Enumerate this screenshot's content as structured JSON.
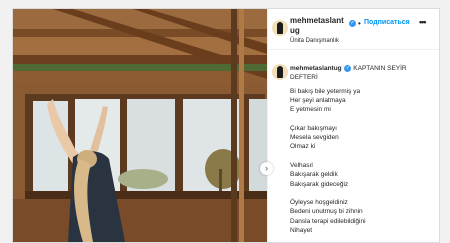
{
  "post": {
    "username": "mehmetaslantug",
    "verified_mark": "✓",
    "dot": "•",
    "follow_label": "Подписаться",
    "more_icon": "•••",
    "subtitle": "Ünita Danışmanlık",
    "caption_title": "KAPTANIN SEYİR DEFTERİ",
    "caption_lines": [
      "Bi bakış bile yetermiş ya",
      "Her şeyi anlatmaya",
      "E yetmesin mi",
      "",
      "Çıkar bakışmayı",
      "Mesela sevgiden",
      "Olmaz ki",
      "",
      "Velhasıl",
      "Bakışarak geldik",
      "Bakışarak gideceğiz",
      "",
      "Öyleyse hoşgeldiniz",
      "Bedeni unutmuş bi zihnin",
      "Dansla terapi edilebildiğini",
      "Nihayet"
    ]
  },
  "media": {
    "description_icon": "photo-of-woman-stretching-icon"
  },
  "nav": {
    "next_icon": "›"
  }
}
